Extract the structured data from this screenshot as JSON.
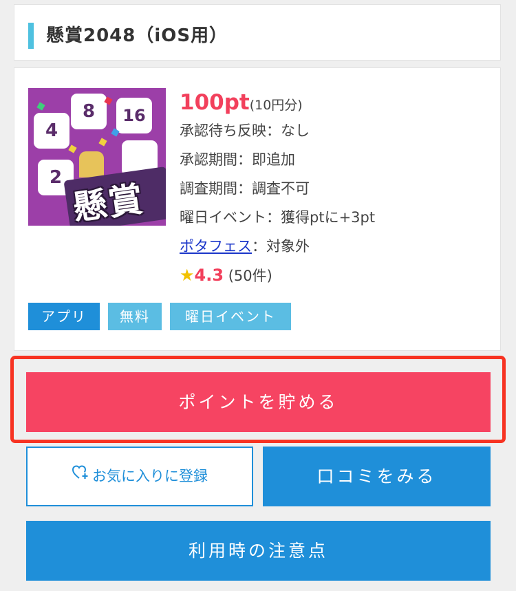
{
  "header": {
    "title": "懸賞2048（iOS用）",
    "accent_color": "#4fc1e0"
  },
  "app": {
    "icon": {
      "tiles": [
        "4",
        "8",
        "16",
        "2"
      ],
      "badge_text": "懸賞",
      "background_color": "#9c3fa8"
    },
    "points": "100pt",
    "points_yen": "(10円分)",
    "details": [
      "承認待ち反映：なし",
      "承認期間：即追加",
      "調査期間：調査不可",
      "曜日イベント：獲得ptに+3pt"
    ],
    "potafes": {
      "link_label": "ポタフェス",
      "value": "：対象外"
    },
    "rating": {
      "star_icon": "star-icon",
      "score": "4.3",
      "count": "(50件)"
    },
    "tags": [
      "アプリ",
      "無料",
      "曜日イベント"
    ]
  },
  "actions": {
    "earn_points": "ポイントを貯める",
    "favorite": "お気に入りに登録",
    "favorite_icon": "heart-plus-icon",
    "reviews": "口コミをみる",
    "notes": "利用時の注意点"
  },
  "colors": {
    "accent_red": "#f64462",
    "points_red": "#f2405c",
    "primary_blue": "#1f8fd9",
    "light_blue": "#5bbde3",
    "highlight_frame": "#f73322",
    "link_blue": "#1a35c9"
  }
}
